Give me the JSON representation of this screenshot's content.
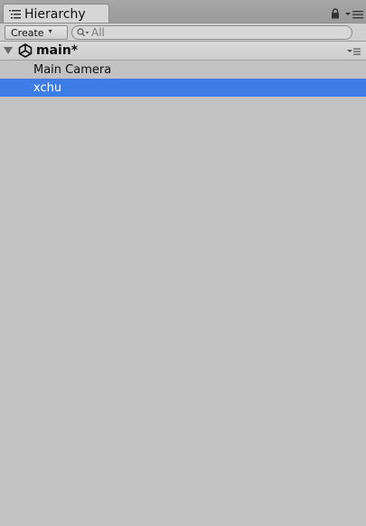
{
  "tab": {
    "title": "Hierarchy",
    "icon": "list-icon"
  },
  "toolbar": {
    "create_label": "Create",
    "create_caret": "▾",
    "search_placeholder": "All",
    "search_icon": "search-icon"
  },
  "scene": {
    "name": "main*",
    "icon": "unity-logo-icon",
    "expanded": true
  },
  "items": [
    {
      "label": "Main Camera",
      "selected": false
    },
    {
      "label": "xchu",
      "selected": true
    }
  ],
  "colors": {
    "panel_background": "#c2c2c2",
    "selection": "#3e7ce6",
    "selected_text": "#ffffff"
  }
}
